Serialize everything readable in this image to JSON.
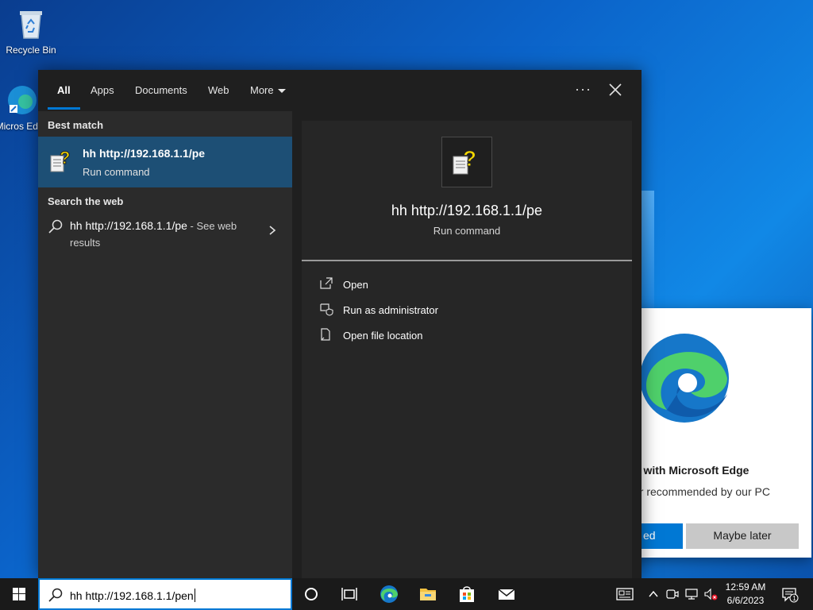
{
  "desktop": {
    "icons": [
      {
        "label": "Recycle Bin"
      },
      {
        "label": "Micros Edge"
      }
    ]
  },
  "edge_popup": {
    "headline": "b with Microsoft Edge",
    "subtext": "er recommended by our PC",
    "primary_button": "ed",
    "secondary_button": "Maybe later"
  },
  "search": {
    "tabs": [
      {
        "label": "All",
        "active": true
      },
      {
        "label": "Apps"
      },
      {
        "label": "Documents"
      },
      {
        "label": "Web"
      },
      {
        "label": "More"
      }
    ],
    "more_options": "···",
    "best_match": {
      "heading": "Best match",
      "title": "hh http://192.168.1.1/pe",
      "subtitle": "Run command"
    },
    "web": {
      "heading": "Search the web",
      "query": "hh http://192.168.1.1/pe",
      "suffix": " - See web results"
    },
    "preview": {
      "title": "hh http://192.168.1.1/pe",
      "subtitle": "Run command",
      "actions": [
        {
          "label": "Open",
          "icon": "open-icon"
        },
        {
          "label": "Run as administrator",
          "icon": "shield-icon"
        },
        {
          "label": "Open file location",
          "icon": "file-location-icon"
        }
      ]
    }
  },
  "taskbar": {
    "search_query": "hh http://192.168.1.1/pen",
    "time": "12:59 AM",
    "date": "6/6/2023",
    "notification_count": "1"
  }
}
